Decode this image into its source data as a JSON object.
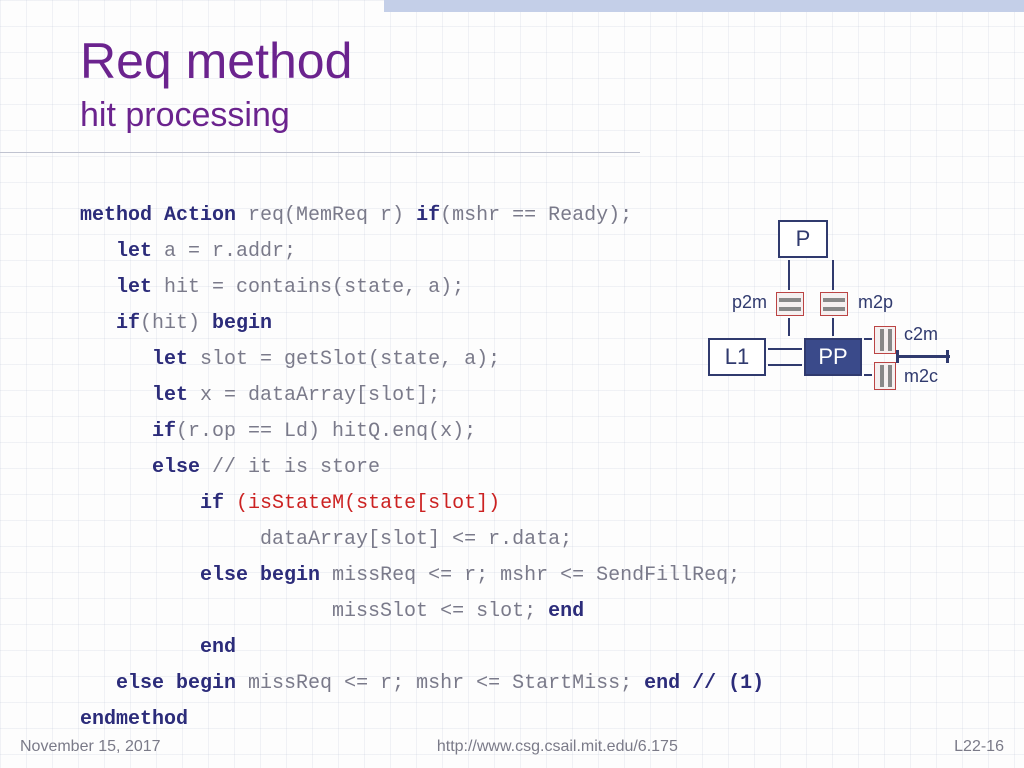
{
  "title": "Req method",
  "subtitle": "hit processing",
  "code": {
    "l1a": "method Action",
    "l1b": " req(MemReq r) ",
    "l1c": "if",
    "l1d": "(mshr == Ready);",
    "l2a": "let",
    "l2b": " a = r.addr;",
    "l3a": "let",
    "l3b": " hit = contains(state, a);",
    "l4a": "if",
    "l4b": "(hit)",
    "l4c": " begin",
    "l5a": "let",
    "l5b": " slot = getSlot(state, a);",
    "l6a": "let",
    "l6b": " x = dataArray[slot];",
    "l7a": "if",
    "l7b": "(r.op == Ld) hitQ.enq(x);",
    "l8a": "else",
    "l8b": " // it is store",
    "l9a": "if",
    "l9b": " (isStateM(state[slot])",
    "l10": "dataArray[slot] <= r.data;",
    "l11a": "else begin",
    "l11b": " missReq <= r; mshr <= SendFillReq;",
    "l12a": "missSlot <= slot;",
    "l12b": " end",
    "l13": "end",
    "l14a": "else begin",
    "l14b": " missReq <= r; mshr <= StartMiss;",
    "l14c": " end // (1)",
    "l15": "endmethod"
  },
  "diagram": {
    "p": "P",
    "l1": "L1",
    "pp": "PP",
    "p2m": "p2m",
    "m2p": "m2p",
    "c2m": "c2m",
    "m2c": "m2c"
  },
  "footer": {
    "date": "November 15, 2017",
    "url": "http://www.csg.csail.mit.edu/6.175",
    "page": "L22-16"
  }
}
